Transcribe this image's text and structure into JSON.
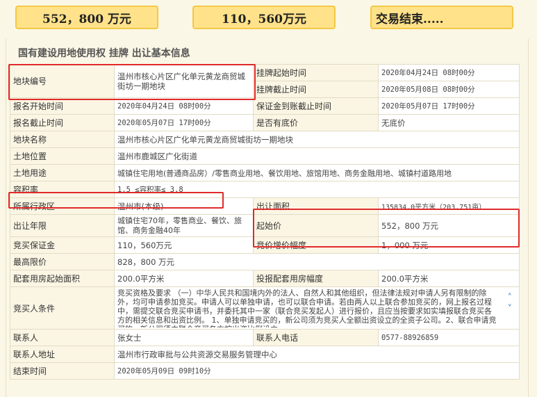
{
  "summary": {
    "start_price": "552，800 万元",
    "deposit": "110，560万元",
    "status": "交易结束....."
  },
  "section_title": "国有建设用地使用权 挂牌 出让基本信息",
  "rows": {
    "parcel_no": {
      "label": "地块编号",
      "value": "温州市核心片区广化单元黄龙商贸城街坊一期地块"
    },
    "listing_start": {
      "label": "挂牌起始时间",
      "value": "2020年04月24日 08时00分"
    },
    "listing_end": {
      "label": "挂牌截止时间",
      "value": "2020年05月08日 08时00分"
    },
    "reg_start": {
      "label": "报名开始时间",
      "value": "2020年04月24日 08时00分"
    },
    "deposit_deadline": {
      "label": "保证金到账截止时间",
      "value": "2020年05月07日 17时00分"
    },
    "reg_end": {
      "label": "报名截止时间",
      "value": "2020年05月07日 17时00分"
    },
    "reserve": {
      "label": "是否有底价",
      "value": "无底价"
    },
    "parcel_name": {
      "label": "地块名称",
      "value": "温州市核心片区广化单元黄龙商贸城街坊一期地块"
    },
    "location": {
      "label": "土地位置",
      "value": "温州市鹿城区广化街道"
    },
    "land_use": {
      "label": "土地用途",
      "value": "城镇住宅用地(普通商品房）/零售商业用地、餐饮用地、旅馆用地、商务金融用地、城镇村道路用地"
    },
    "far": {
      "label": "容积率",
      "value": "1.5 ≤容积率≤ 3.8"
    },
    "district": {
      "label": "所属行政区",
      "value": "温州市(本级)"
    },
    "area": {
      "label": "出让面积",
      "value": "135834.0平方米（203.751亩）"
    },
    "term": {
      "label": "出让年限",
      "value": "城镇住宅70年，零售商业、餐饮、旅馆、商务金融40年"
    },
    "start_price": {
      "label": "起始价",
      "value": "552，800 万元"
    },
    "bid_deposit": {
      "label": "竞买保证金",
      "value": "110，560万元"
    },
    "increment": {
      "label": "竞价增价幅度",
      "value": "1，000 万元"
    },
    "max_price": {
      "label": "最高限价",
      "value": "828，800 万元"
    },
    "housing_start": {
      "label": "配套用房起始面积",
      "value": "200.0平方米"
    },
    "housing_increment": {
      "label": "投报配套用房幅度",
      "value": "200.0平方米"
    },
    "bidder_conditions": {
      "label": "竞买人条件",
      "value": "竞买资格及要求 （一）中华人民共和国境内外的法人、自然人和其他组织，但法律法规对申请人另有限制的除外，均可申请参加竞买。申请人可以单独申请，也可以联合申请。若由两人以上联合参加竞买的，网上报名过程中，需提交联合竞买申请书，并委托其中一家（联合竞买发起人）进行报价，且应当按要求如实填报联合竞买各方的相关信息和出资比例。 1、单独申请竞买的，新公司须为竞买人全额出资设立的全资子公司。2、联合申请竞买的，新公司须由联合竞买各方按出资比例设立"
    },
    "contact": {
      "label": "联系人",
      "value": "张女士"
    },
    "phone": {
      "label": "联系人电话",
      "value": "0577-88926859"
    },
    "address": {
      "label": "联系人地址",
      "value": "温州市行政审批与公共资源交易服务管理中心"
    },
    "end_time": {
      "label": "结束时间",
      "value": "2020年05月09日 09时10分"
    }
  },
  "colors": {
    "highlight": "#e02a2a",
    "pill_bg": "#ffe28a",
    "label_bg": "#fbf6e4"
  }
}
